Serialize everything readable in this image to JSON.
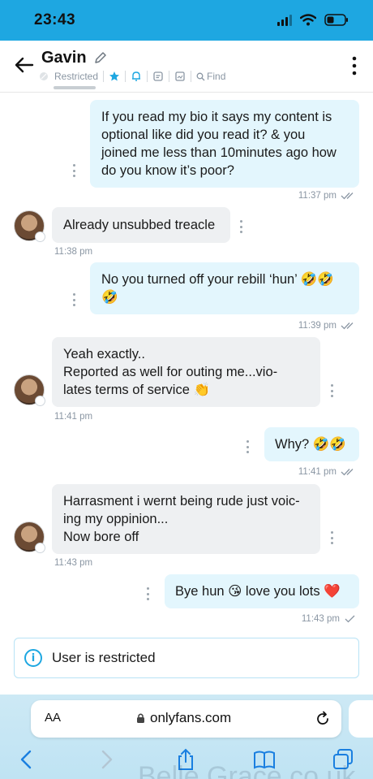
{
  "status_bar": {
    "time": "23:43"
  },
  "header": {
    "contact_name": "Gavin",
    "restricted_label": "Restricted",
    "find_label": "Find"
  },
  "messages": [
    {
      "dir": "out",
      "lines": [
        "If you read my bio it says my content is",
        "optional like did you read it? & you",
        "joined me less than 10minutes ago how",
        "do you know it’s poor?"
      ],
      "time": "11:37 pm"
    },
    {
      "dir": "in",
      "lines": [
        "Already unsubbed treacle"
      ],
      "time": "11:38 pm"
    },
    {
      "dir": "out",
      "lines": [
        "No you turned off your rebill ‘hun’ 🤣🤣",
        "🤣"
      ],
      "time": "11:39 pm"
    },
    {
      "dir": "in",
      "lines": [
        "Yeah exactly..",
        "Reported as well for outing me...vio-",
        "lates terms of service 👏"
      ],
      "time": "11:41 pm"
    },
    {
      "dir": "out",
      "lines": [
        "Why? 🤣🤣"
      ],
      "time": "11:41 pm"
    },
    {
      "dir": "in",
      "lines": [
        "Harrasment i wernt being rude just voic-",
        "ing my oppinion...",
        "Now bore off"
      ],
      "time": "11:43 pm"
    },
    {
      "dir": "out",
      "lines": [
        "Bye hun 😘 love you lots ❤️"
      ],
      "time": "11:43 pm"
    }
  ],
  "restricted_notice": "User is restricted",
  "browser": {
    "aa_label": "AA",
    "url": "onlyfans.com",
    "watermark": "Belle Grace.co.uk"
  },
  "colors": {
    "accent": "#1ea7e1",
    "out_bubble": "#e3f6fd",
    "in_bubble": "#eef0f2"
  }
}
